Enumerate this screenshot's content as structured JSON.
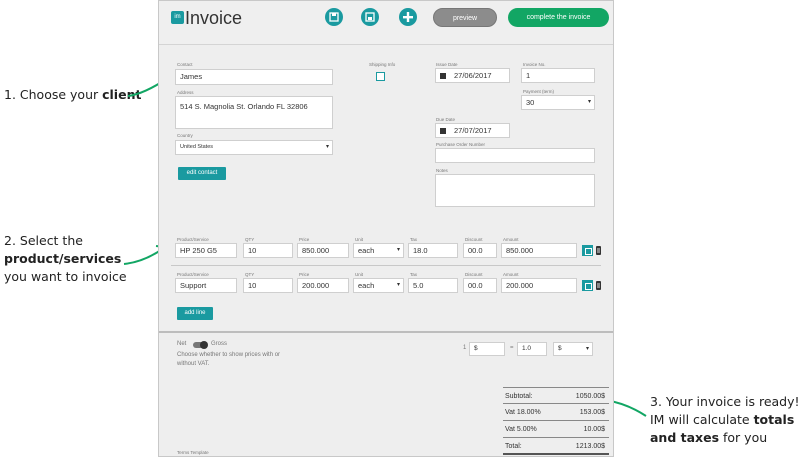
{
  "annotations": {
    "step1_pre": "1. Choose your ",
    "step1_bold": "client",
    "step2_line1": "2. Select the",
    "step2_bold": "product/services",
    "step2_line3": "you want to invoice",
    "step3_line1": "3. Your invoice is ready!",
    "step3_pre": "IM will calculate ",
    "step3_bold1": "totals",
    "step3_bold2": "and taxes",
    "step3_post": " for you"
  },
  "header": {
    "logo": "im",
    "title": "Invoice",
    "preview_label": "preview",
    "complete_label": "complete the invoice"
  },
  "client": {
    "contact_label": "Contact",
    "contact_value": "James",
    "address_label": "Address",
    "address_value": "514 S. Magnolia St. Orlando FL 32806",
    "country_label": "Country",
    "country_value": "United States",
    "edit_contact_label": "edit contact",
    "shipping_label": "Shipping Info"
  },
  "invoice_meta": {
    "issue_date_label": "Issue Date",
    "issue_date_value": "27/06/2017",
    "invoice_no_label": "Invoice No.",
    "invoice_no_value": "1",
    "payment_label": "Payment (term)",
    "payment_value": "30",
    "due_date_label": "Due Date",
    "due_date_value": "27/07/2017",
    "po_label": "Purchase Order Number",
    "notes_label": "Notes"
  },
  "line_labels": {
    "product": "Product/Service",
    "qty": "QTY",
    "price": "Price",
    "unit": "Unit",
    "tax": "Tax",
    "discount": "Discount",
    "amount": "Amount"
  },
  "lines": [
    {
      "product": "HP 250 G5",
      "qty": "10",
      "price": "850.000",
      "unit": "each",
      "tax": "18.0",
      "discount": "00.0",
      "amount": "850.000"
    },
    {
      "product": "Support",
      "qty": "10",
      "price": "200.000",
      "unit": "each",
      "tax": "5.0",
      "discount": "00.0",
      "amount": "200.000"
    }
  ],
  "add_line_label": "add line",
  "pricing": {
    "net_label": "Net",
    "gross_label": "Gross",
    "help": "Choose whether to show prices with or without VAT.",
    "cur1_sym": "1",
    "cur1_val": "$",
    "eq": "=",
    "rate": "1.0",
    "cur2_val": "$"
  },
  "totals": {
    "subtotal_label": "Subtotal:",
    "subtotal_value": "1050.00$",
    "vat1_label": "Vat 18.00%",
    "vat1_value": "153.00$",
    "vat2_label": "Vat 5.00%",
    "vat2_value": "10.00$",
    "total_label": "Total:",
    "total_value": "1213.00$"
  },
  "terms_label": "Terms Template",
  "colors": {
    "accent": "#1a9aa0",
    "complete": "#12a664",
    "preview": "#8c8c8c"
  },
  "icons": [
    "save-icon",
    "save-copy-icon",
    "add-icon",
    "calendar-icon",
    "trash-icon"
  ]
}
